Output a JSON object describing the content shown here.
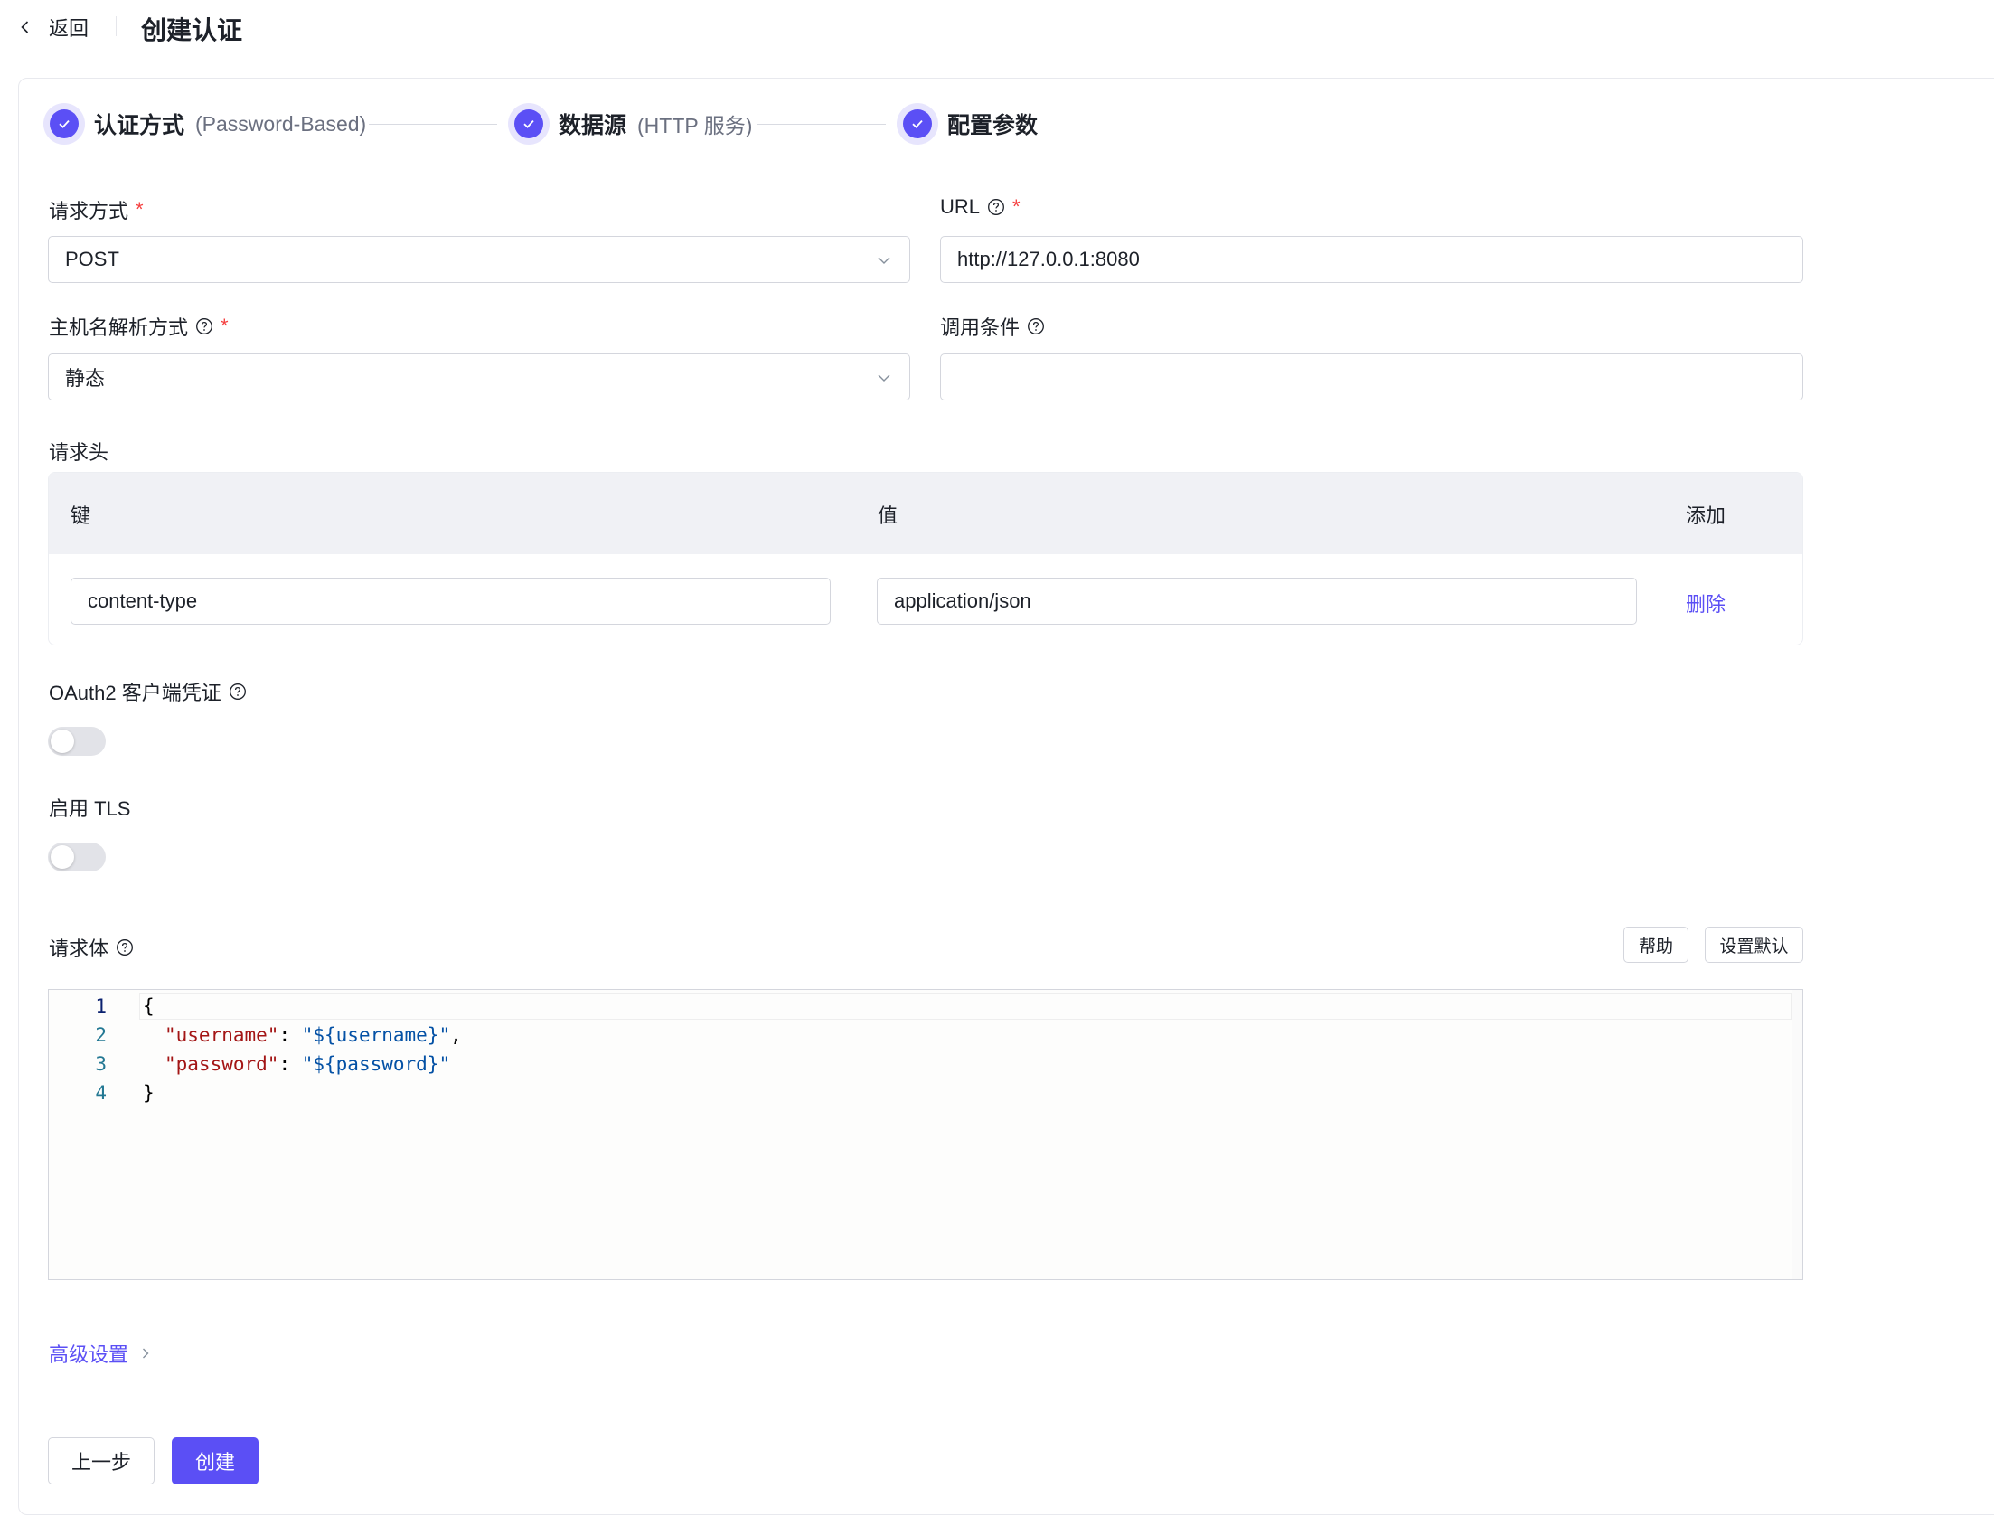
{
  "header": {
    "back_label": "返回",
    "title": "创建认证"
  },
  "steps": [
    {
      "title": "认证方式",
      "desc": "(Password-Based)"
    },
    {
      "title": "数据源",
      "desc": "(HTTP 服务)"
    },
    {
      "title": "配置参数",
      "desc": ""
    }
  ],
  "form": {
    "method": {
      "label": "请求方式",
      "required": "*",
      "value": "POST"
    },
    "url": {
      "label": "URL",
      "required": "*",
      "value": "http://127.0.0.1:8080"
    },
    "host_resolve": {
      "label": "主机名解析方式",
      "required": "*",
      "value": "静态"
    },
    "condition": {
      "label": "调用条件",
      "value": ""
    },
    "headers": {
      "label": "请求头",
      "col_key": "键",
      "col_value": "值",
      "add_label": "添加",
      "rows": [
        {
          "key": "content-type",
          "value": "application/json",
          "delete_label": "删除"
        }
      ]
    },
    "oauth2": {
      "label": "OAuth2 客户端凭证",
      "enabled": false
    },
    "tls": {
      "label": "启用 TLS",
      "enabled": false
    },
    "body": {
      "label": "请求体",
      "help_btn": "帮助",
      "default_btn": "设置默认",
      "line_numbers": [
        "1",
        "2",
        "3",
        "4"
      ],
      "lines": [
        {
          "open": "{"
        },
        {
          "key": "\"username\"",
          "sep": ": ",
          "value": "\"${username}\"",
          "tail": ","
        },
        {
          "key": "\"password\"",
          "sep": ": ",
          "value": "\"${password}\"",
          "tail": ""
        },
        {
          "close": "}"
        }
      ]
    },
    "advanced_label": "高级设置"
  },
  "footer": {
    "prev_label": "上一步",
    "create_label": "创建"
  },
  "colors": {
    "accent": "#5b4ff5",
    "required": "#f53f3f"
  }
}
